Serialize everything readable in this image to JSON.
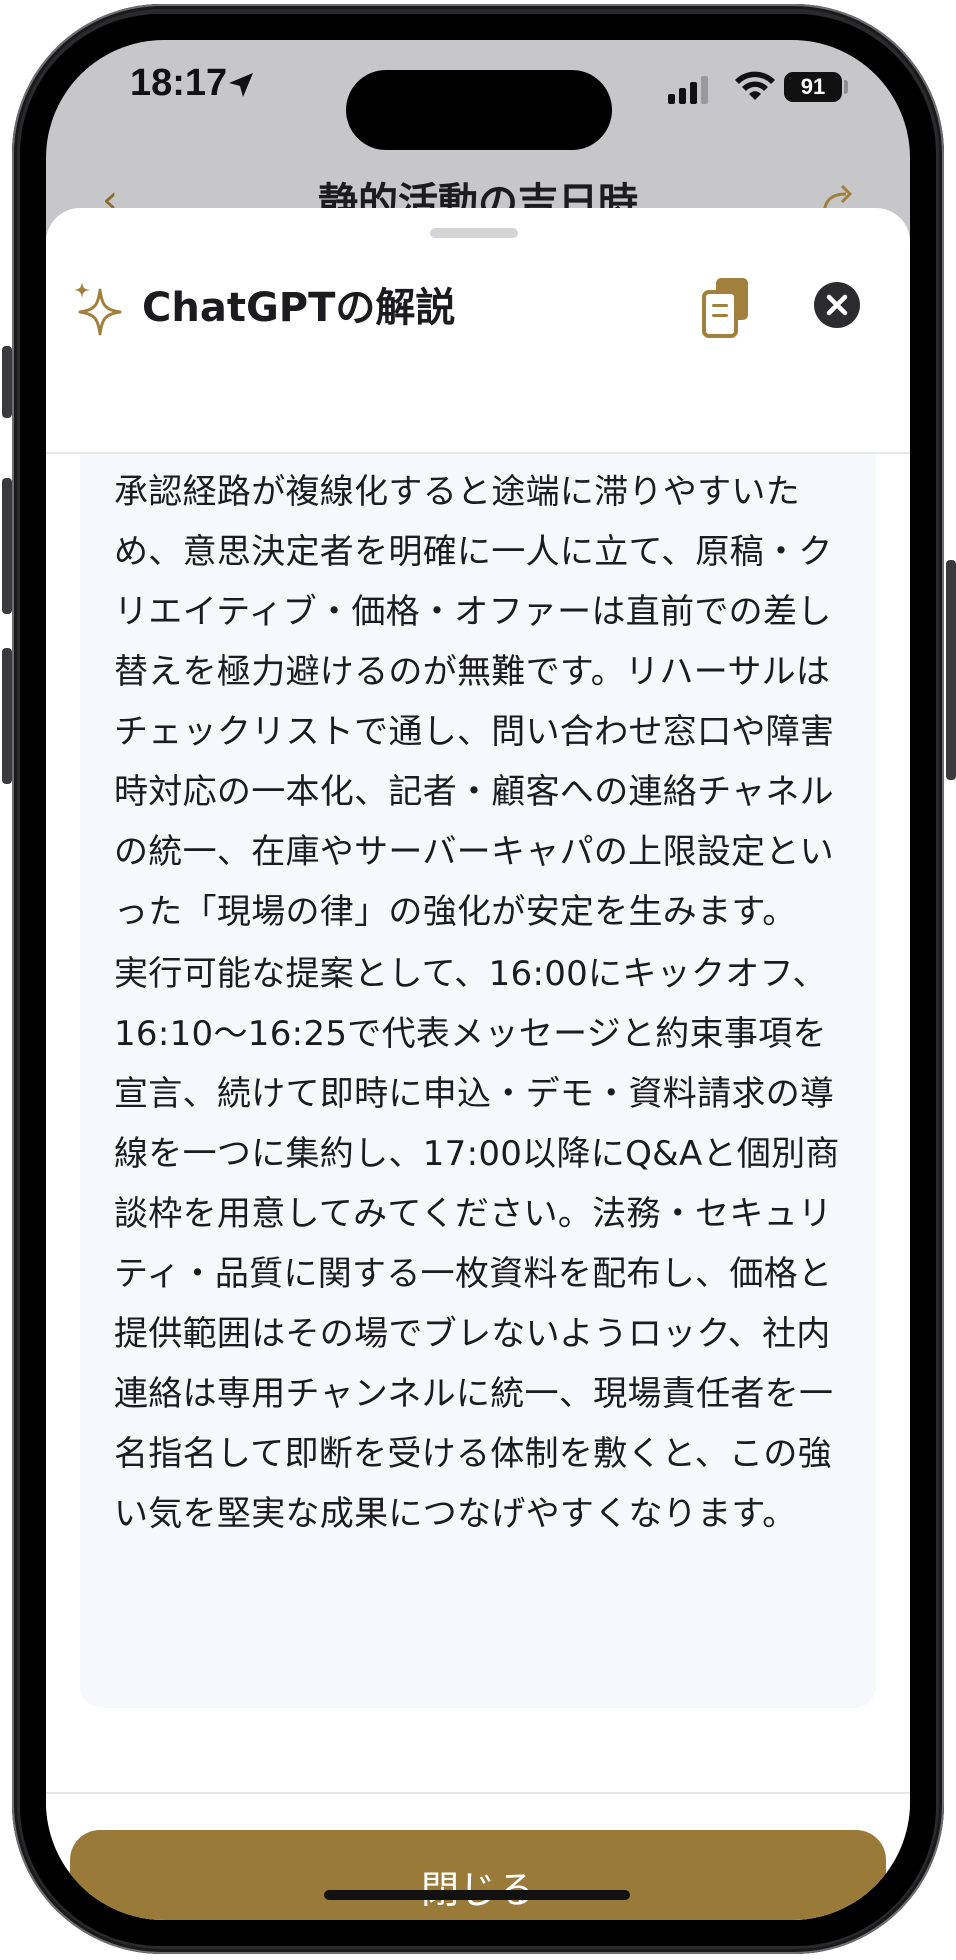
{
  "status_bar": {
    "time": "18:17",
    "battery": "91"
  },
  "background_screen": {
    "title": "静的活動の吉日時",
    "back_icon": "chevron-left-icon",
    "share_icon": "share-icon"
  },
  "sheet": {
    "title": "ChatGPTの解説",
    "icons": {
      "title": "sparkle-icon",
      "copy": "copy-icon",
      "close": "close-icon"
    },
    "paragraphs": [
      "承認経路が複線化すると途端に滞りやすいため、意思決定者を明確に一人に立て、原稿・クリエイティブ・価格・オファーは直前での差し替えを極力避けるのが無難です。リハーサルはチェックリストで通し、問い合わせ窓口や障害時対応の一本化、記者・顧客への連絡チャネルの統一、在庫やサーバーキャパの上限設定といった「現場の律」の強化が安定を生みます。",
      "実行可能な提案として、16:00にキックオフ、16:10〜16:25で代表メッセージと約束事項を宣言、続けて即時に申込・デモ・資料請求の導線を一つに集約し、17:00以降にQ&Aと個別商談枠を用意してみてください。法務・セキュリティ・品質に関する一枚資料を配布し、価格と提供範囲はその場でブレないようロック、社内連絡は専用チャンネルに統一、現場責任者を一名指名して即断を受ける体制を敷くと、この強い気を堅実な成果につなげやすくなります。"
    ],
    "close_button_label": "閉じる"
  },
  "colors": {
    "accent": "#9a7a38",
    "icon_gold": "#a0803c",
    "text": "#1c1c1e",
    "card_bg": "#f7f8fb"
  }
}
